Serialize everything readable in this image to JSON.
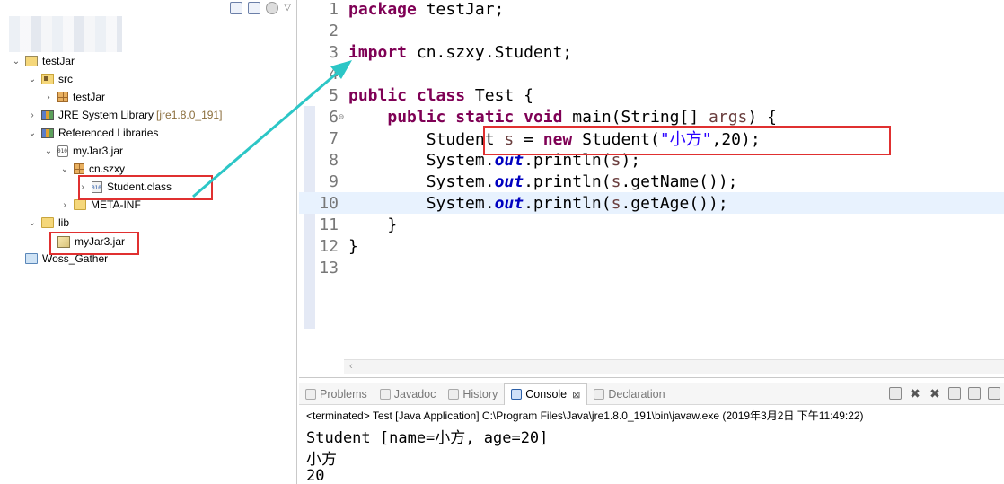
{
  "explorer": {
    "tree": [
      {
        "label": "testJar",
        "decoration": "",
        "expanded": "open",
        "icon": "project-folder-icon"
      },
      {
        "label": "src",
        "decoration": "",
        "expanded": "open",
        "icon": "source-folder-icon"
      },
      {
        "label": "testJar",
        "decoration": "",
        "expanded": "closed",
        "icon": "package-icon"
      },
      {
        "label": "JRE System Library",
        "decoration": "[jre1.8.0_191]",
        "expanded": "closed",
        "icon": "library-icon"
      },
      {
        "label": "Referenced Libraries",
        "decoration": "",
        "expanded": "open",
        "icon": "library-icon"
      },
      {
        "label": "myJar3.jar",
        "decoration": "",
        "expanded": "open",
        "icon": "jar-icon"
      },
      {
        "label": "cn.szxy",
        "decoration": "",
        "expanded": "open",
        "icon": "package-icon"
      },
      {
        "label": "Student.class",
        "decoration": "",
        "expanded": "closed",
        "icon": "class-file-icon"
      },
      {
        "label": "META-INF",
        "decoration": "",
        "expanded": "closed",
        "icon": "folder-icon"
      },
      {
        "label": "lib",
        "decoration": "",
        "expanded": "open",
        "icon": "folder-icon"
      },
      {
        "label": "myJar3.jar",
        "decoration": "",
        "expanded": "",
        "icon": "jar-library-icon"
      },
      {
        "label": "Woss_Gather",
        "decoration": "",
        "expanded": "",
        "icon": "working-set-icon"
      }
    ]
  },
  "editor": {
    "line_numbers": [
      "1",
      "2",
      "3",
      "4",
      "5",
      "6",
      "7",
      "8",
      "9",
      "10",
      "11",
      "12",
      "13"
    ],
    "fold_marker": "⊖",
    "line1": {
      "kw": "package",
      "rest": " testJar;"
    },
    "line3": {
      "kw": "import",
      "rest": " cn.szxy.Student;"
    },
    "line5": {
      "kw1": "public",
      "kw2": "class",
      "rest": " Test {"
    },
    "line6": {
      "kw1": "public",
      "kw2": "static",
      "kw3": "void",
      "a": " main(String[] ",
      "var": "args",
      "b": ") {"
    },
    "line7": {
      "a": "        Student ",
      "var": "s",
      "b": " = ",
      "kw": "new",
      "c": " Student(",
      "str": "\"小方\"",
      "d": ",20);"
    },
    "line8": {
      "a": "        System.",
      "fld": "out",
      "b": ".println(",
      "var": "s",
      "c": ");"
    },
    "line9": {
      "a": "        System.",
      "fld": "out",
      "b": ".println(",
      "var": "s",
      "c": ".getName());"
    },
    "line10": {
      "a": "        System.",
      "fld": "out",
      "b": ".println(",
      "var": "s",
      "c": ".getAge());"
    },
    "line11": "    }",
    "line12": "}"
  },
  "console": {
    "tabs": [
      {
        "label": "Problems"
      },
      {
        "label": "Javadoc"
      },
      {
        "label": "History"
      },
      {
        "label": "Console",
        "close": "⊠"
      },
      {
        "label": "Declaration"
      }
    ],
    "terminated": "<terminated> Test [Java Application] C:\\Program Files\\Java\\jre1.8.0_191\\bin\\javaw.exe (2019年3月2日 下午11:49:22)",
    "output": [
      "Student [name=小方, age=20]",
      "小方",
      "20"
    ]
  },
  "colors": {
    "keyword": "#7f0055",
    "string": "#2a00ff",
    "field": "#0000c0",
    "highlight_box": "#e03030",
    "arrow": "#2cc6c6"
  }
}
